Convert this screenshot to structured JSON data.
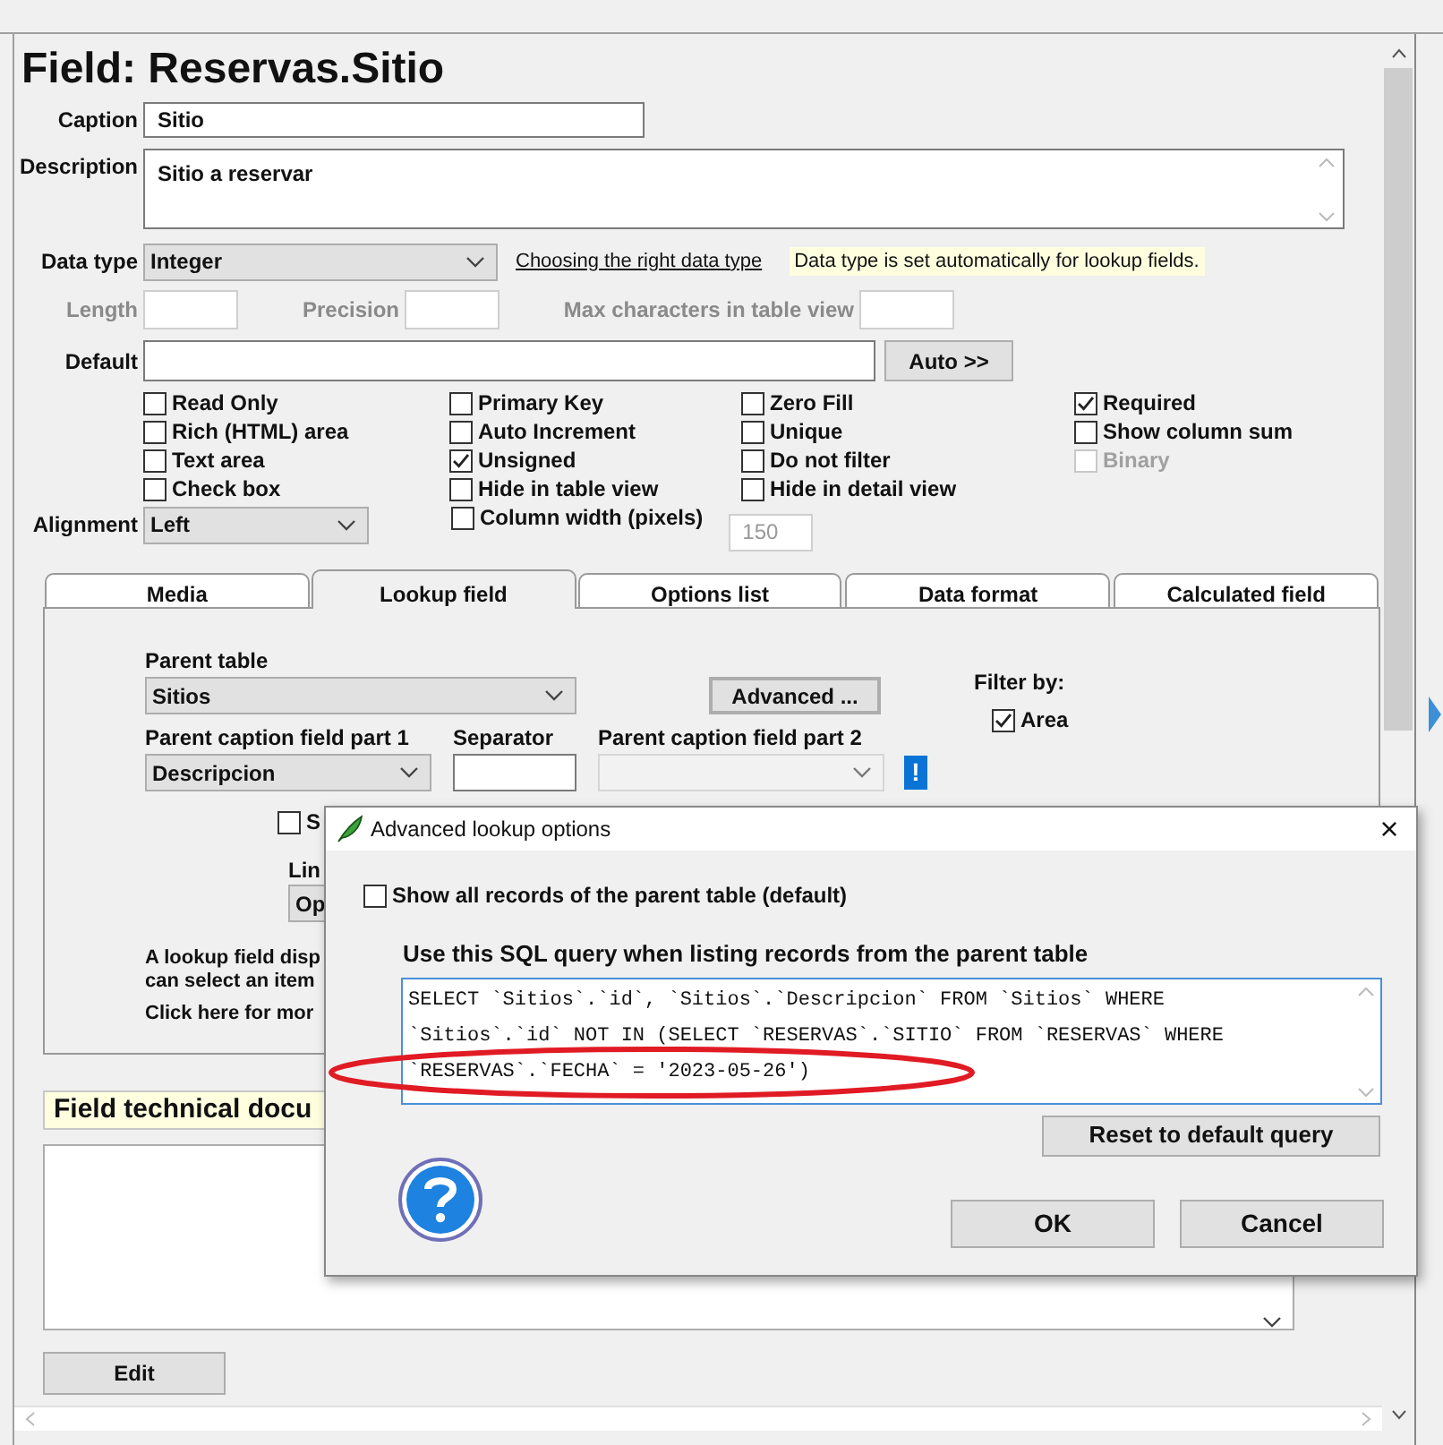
{
  "title": "Field: Reservas.Sitio",
  "caption": {
    "label": "Caption",
    "value": "Sitio"
  },
  "description": {
    "label": "Description",
    "value": "Sitio a reservar"
  },
  "data_type": {
    "label": "Data type",
    "value": "Integer",
    "link": "Choosing the right data type",
    "note": "Data type is set automatically for lookup fields."
  },
  "sizes": [
    {
      "label": "Length",
      "disabled": true
    },
    {
      "label": "Precision",
      "disabled": true
    },
    {
      "label": "Max characters in table view",
      "disabled": true
    }
  ],
  "default": {
    "label": "Default",
    "button": "Auto >>"
  },
  "options": [
    [
      {
        "label": "Read Only",
        "checked": false,
        "disabled": false
      },
      {
        "label": "Primary Key",
        "checked": false,
        "disabled": false
      },
      {
        "label": "Zero Fill",
        "checked": false,
        "disabled": false
      },
      {
        "label": "Required",
        "checked": true,
        "disabled": false
      }
    ],
    [
      {
        "label": "Rich (HTML) area",
        "checked": false,
        "disabled": false
      },
      {
        "label": "Auto Increment",
        "checked": false,
        "disabled": false
      },
      {
        "label": "Unique",
        "checked": false,
        "disabled": false
      },
      {
        "label": "Show column sum",
        "checked": false,
        "disabled": false
      }
    ],
    [
      {
        "label": "Text area",
        "checked": false,
        "disabled": false
      },
      {
        "label": "Unsigned",
        "checked": true,
        "disabled": false
      },
      {
        "label": "Do not filter",
        "checked": false,
        "disabled": false
      },
      {
        "label": "Binary",
        "checked": false,
        "disabled": true
      }
    ],
    [
      {
        "label": "Check box",
        "checked": false,
        "disabled": false
      },
      {
        "label": "Hide in table view",
        "checked": false,
        "disabled": false
      },
      {
        "label": "Hide in detail view",
        "checked": false,
        "disabled": false
      }
    ]
  ],
  "alignment": {
    "label": "Alignment",
    "value": "Left"
  },
  "column_width": {
    "label": "Column width (pixels)",
    "checked": false,
    "value": "150",
    "disabled": true
  },
  "tabs": [
    {
      "label": "Media",
      "selected": false
    },
    {
      "label": "Lookup field",
      "selected": true
    },
    {
      "label": "Options list",
      "selected": false
    },
    {
      "label": "Data format",
      "selected": false
    },
    {
      "label": "Calculated field",
      "selected": false
    }
  ],
  "lookup": {
    "parent_table": {
      "label": "Parent table",
      "value": "Sitios"
    },
    "advanced_button": "Advanced ...",
    "filter_by": {
      "label": "Filter by:",
      "options": [
        {
          "label": "Area",
          "checked": true
        }
      ]
    },
    "part1": {
      "label": "Parent caption field part 1",
      "value": "Descripcion"
    },
    "separator": {
      "label": "Separator"
    },
    "part2": {
      "label": "Parent caption field part 2",
      "disabled": true
    },
    "warning_button": "!",
    "partial_checkbox": {
      "label": "S",
      "checked": false
    },
    "link_label": "Lin",
    "link_button": "Op",
    "help_lines": [
      "A lookup field disp",
      "can select an item"
    ],
    "more_link": "Click here for mor"
  },
  "technical_doc": {
    "heading": "Field technical docu",
    "button": "Edit"
  },
  "dialog": {
    "title": "Advanced lookup options",
    "close": "×",
    "show_all": {
      "label": "Show all records of the parent table (default)",
      "checked": false
    },
    "query_label": "Use this SQL query when listing records from the parent table",
    "query": "SELECT `Sitios`.`id`, `Sitios`.`Descripcion` FROM `Sitios` WHERE `Sitios`.`id` NOT IN (SELECT `RESERVAS`.`SITIO` FROM `RESERVAS` WHERE `RESERVAS`.`FECHA` = '2023-05-26')",
    "reset_button": "Reset to default query",
    "buttons": [
      "OK",
      "Cancel"
    ]
  }
}
